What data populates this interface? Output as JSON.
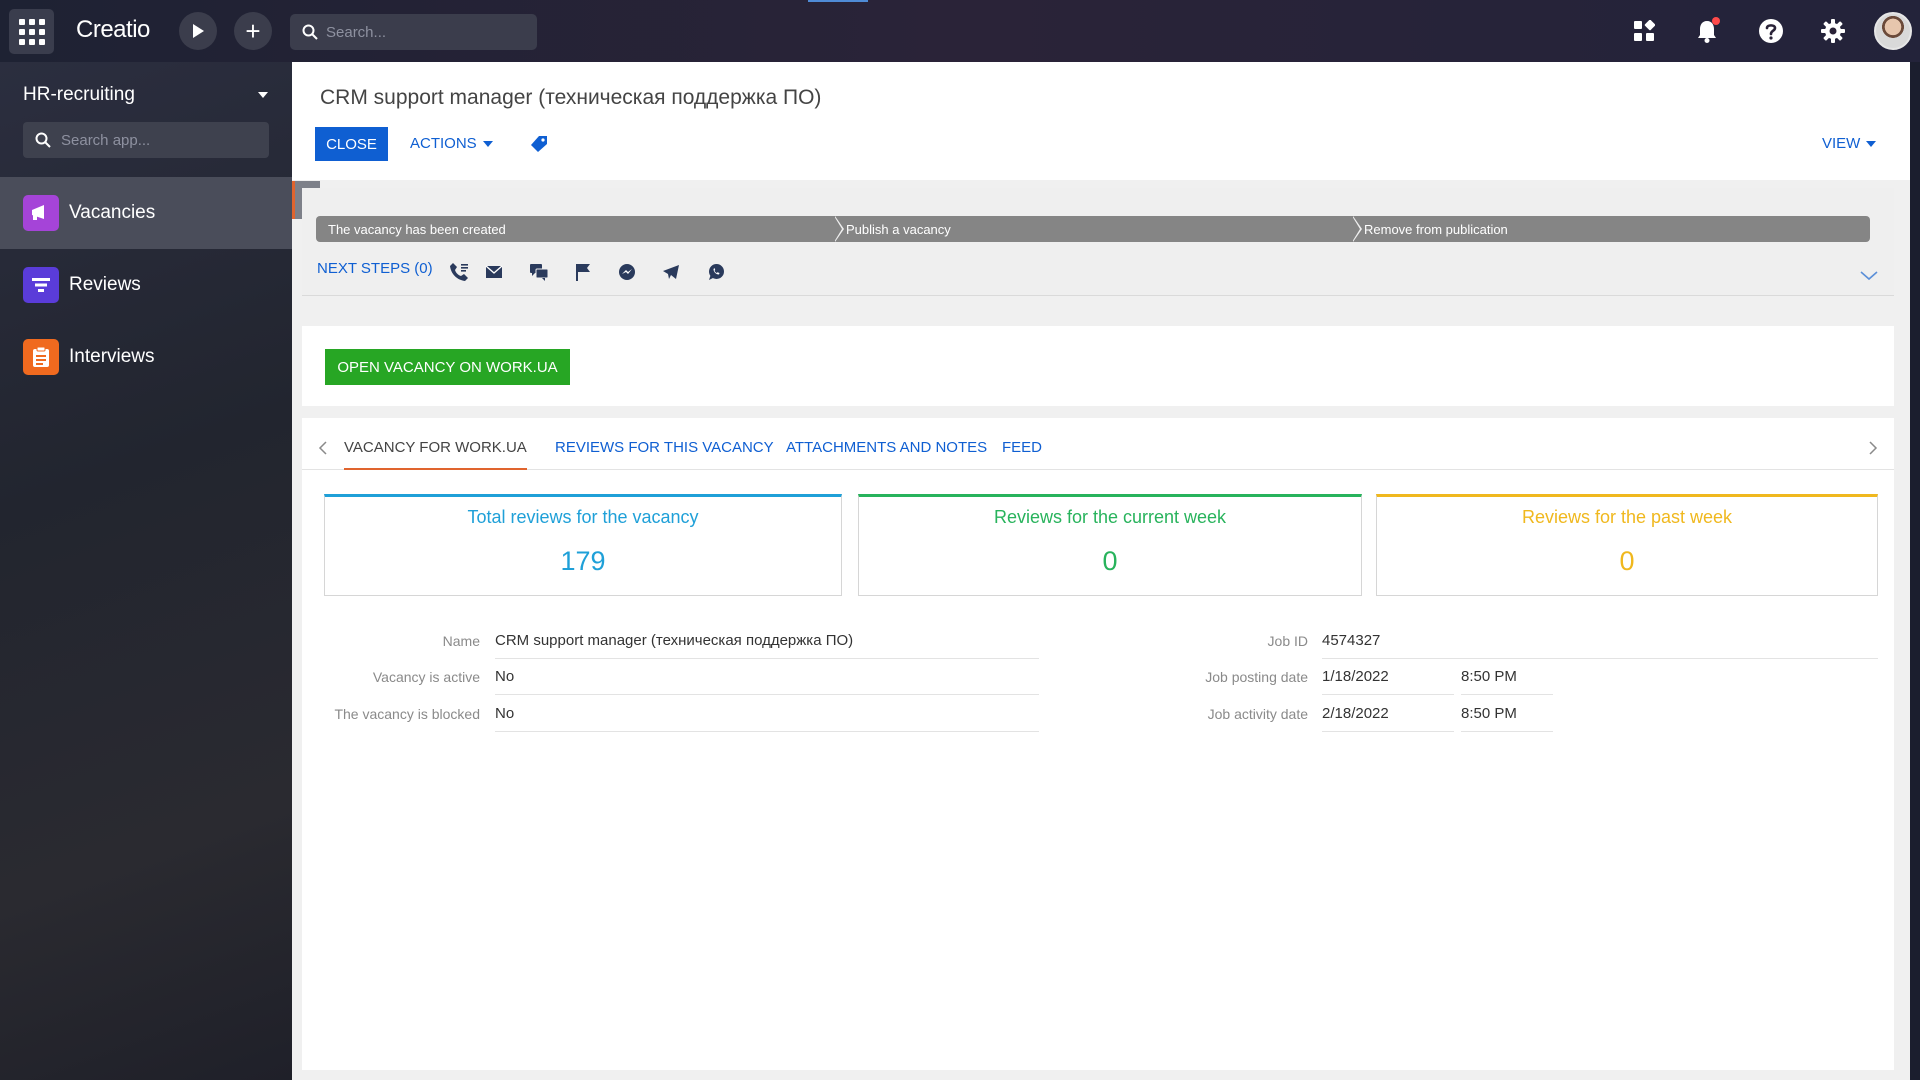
{
  "topbar": {
    "logo": "Creatio",
    "search_placeholder": "Search...",
    "plus_label": "+"
  },
  "sidebar": {
    "app_name": "HR-recruiting",
    "search_placeholder": "Search app...",
    "items": [
      {
        "label": "Vacancies",
        "icon": "megaphone-icon",
        "color": "#a544d8",
        "active": true
      },
      {
        "label": "Reviews",
        "icon": "funnel-icon",
        "color": "#5a3cd9",
        "active": false
      },
      {
        "label": "Interviews",
        "icon": "clipboard-icon",
        "color": "#f06a1f",
        "active": false
      }
    ]
  },
  "page": {
    "title": "CRM support manager (техническая поддержка ПО)",
    "close_label": "CLOSE",
    "actions_label": "ACTIONS",
    "view_label": "VIEW"
  },
  "stages": [
    {
      "label": "The vacancy has been created"
    },
    {
      "label": "Publish a vacancy"
    },
    {
      "label": "Remove from publication"
    }
  ],
  "next_steps": {
    "label": "NEXT STEPS (0)"
  },
  "action_block": {
    "button_label": "OPEN VACANCY ON WORK.UA"
  },
  "tabs": [
    {
      "label": "VACANCY FOR WORK.UA",
      "active": true
    },
    {
      "label": "REVIEWS FOR THIS VACANCY",
      "active": false
    },
    {
      "label": "ATTACHMENTS AND NOTES",
      "active": false
    },
    {
      "label": "FEED",
      "active": false
    }
  ],
  "dashboards": [
    {
      "title": "Total reviews for the vacancy",
      "value": "179",
      "color": "#1fa0d8"
    },
    {
      "title": "Reviews for the current week",
      "value": "0",
      "color": "#28b35c"
    },
    {
      "title": "Reviews for the past week",
      "value": "0",
      "color": "#f0b81e"
    }
  ],
  "fields_left": [
    {
      "label": "Name",
      "value": "CRM support manager (техническая поддержка ПО)"
    },
    {
      "label": "Vacancy is active",
      "value": "No"
    },
    {
      "label": "The vacancy is blocked",
      "value": "No"
    }
  ],
  "fields_right": [
    {
      "label": "Job ID",
      "value": "4574327",
      "time": ""
    },
    {
      "label": "Job posting date",
      "value": "1/18/2022",
      "time": "8:50 PM"
    },
    {
      "label": "Job activity date",
      "value": "2/18/2022",
      "time": "8:50 PM"
    }
  ],
  "colors": {
    "accent": "#0f5fd2",
    "green": "#27a624",
    "tab_active": "#e0642e"
  }
}
